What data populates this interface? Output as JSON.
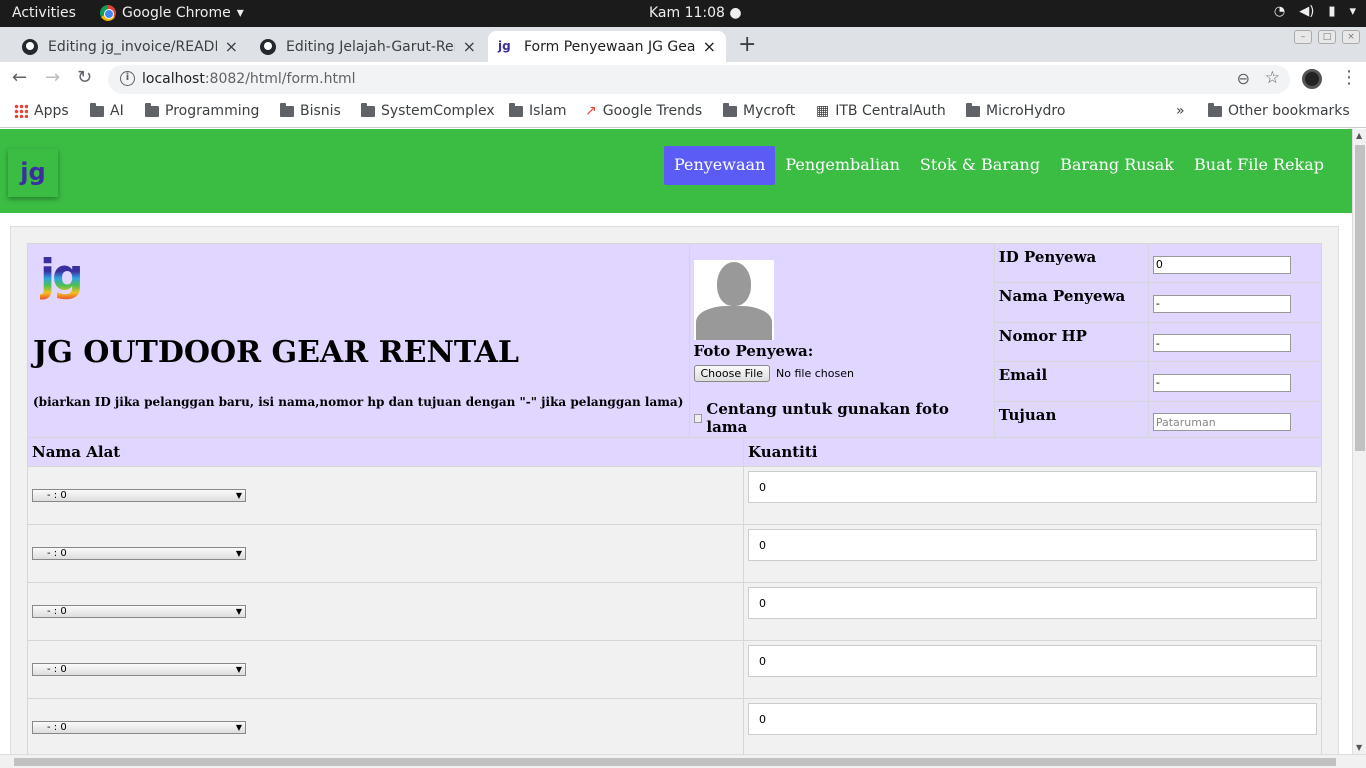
{
  "os": {
    "activities": "Activities",
    "app_name": "Google Chrome",
    "clock": "Kam 11:08"
  },
  "browser": {
    "tabs": [
      {
        "title": "Editing jg_invoice/READM",
        "icon": "github-icon"
      },
      {
        "title": "Editing Jelajah-Garut-Ren",
        "icon": "github-icon"
      },
      {
        "title": "Form Penyewaan JG Gear",
        "icon": "jg-icon"
      }
    ],
    "url_host": "localhost",
    "url_rest": ":8082/html/form.html",
    "bookmarks": [
      "Apps",
      "AI",
      "Programming",
      "Bisnis",
      "SystemComplex",
      "Islam",
      "Google Trends",
      "Mycroft",
      "ITB CentralAuth",
      "MicroHydro"
    ],
    "bookmarks_overflow": "»",
    "other_bookmarks": "Other bookmarks"
  },
  "page": {
    "logo_text": "jg",
    "nav": [
      "Penyewaan",
      "Pengembalian",
      "Stok & Barang",
      "Barang Rusak",
      "Buat File Rekap"
    ],
    "title": "JG OUTDOOR GEAR RENTAL",
    "note": "(biarkan ID jika pelanggan baru, isi nama,nomor hp dan tujuan dengan \"-\" jika pelanggan lama)",
    "photo_label": "Foto Penyewa:",
    "choose_file": "Choose File",
    "no_file": "No file chosen",
    "use_old_photo": "Centang untuk gunakan foto lama",
    "fields": [
      {
        "label": "ID Penyewa",
        "value": "0",
        "placeholder": ""
      },
      {
        "label": "Nama Penyewa",
        "value": "-",
        "placeholder": ""
      },
      {
        "label": "Nomor HP",
        "value": "-",
        "placeholder": ""
      },
      {
        "label": "Email",
        "value": "-",
        "placeholder": ""
      },
      {
        "label": "Tujuan",
        "value": "",
        "placeholder": "Pataruman"
      }
    ],
    "items_header": {
      "name": "Nama Alat",
      "qty": "Kuantiti"
    },
    "items": [
      {
        "select": "- : 0",
        "qty": "0"
      },
      {
        "select": "- : 0",
        "qty": "0"
      },
      {
        "select": "- : 0",
        "qty": "0"
      },
      {
        "select": "- : 0",
        "qty": "0"
      },
      {
        "select": "- : 0",
        "qty": "0"
      }
    ]
  },
  "colors": {
    "navbar": "#3bbd44",
    "nav_active": "#5a5cf5",
    "lavender": "#e0d6ff"
  }
}
